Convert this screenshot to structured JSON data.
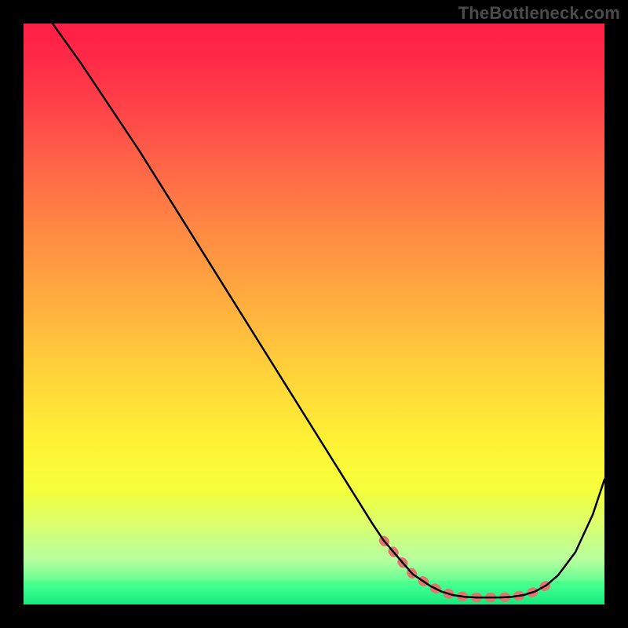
{
  "watermark": "TheBottleneck.com",
  "chart_data": {
    "type": "line",
    "title": "",
    "xlabel": "",
    "ylabel": "",
    "xlim": [
      0,
      100
    ],
    "ylim": [
      0,
      100
    ],
    "grid": false,
    "series": [
      {
        "name": "curve",
        "color": "#000000",
        "x": [
          5,
          10,
          15,
          20,
          25,
          30,
          35,
          40,
          45,
          50,
          55,
          60,
          62,
          65,
          67,
          70,
          72,
          74,
          76,
          78,
          80,
          82,
          84,
          86,
          88,
          90,
          92,
          95,
          98,
          100
        ],
        "y": [
          100,
          93,
          85.5,
          78,
          70,
          62,
          54,
          46,
          38,
          30,
          22,
          14,
          11,
          7.5,
          5.2,
          3.2,
          2.2,
          1.6,
          1.3,
          1.2,
          1.2,
          1.2,
          1.3,
          1.6,
          2.2,
          3.3,
          5.0,
          9.0,
          15.5,
          21.5
        ]
      },
      {
        "name": "highlight-band",
        "color": "#e2766f",
        "x": [
          62,
          65,
          67,
          70,
          72,
          74,
          76,
          78,
          80,
          82,
          84,
          86,
          88,
          90,
          91.5
        ],
        "y": [
          11,
          7.5,
          5.2,
          3.2,
          2.2,
          1.6,
          1.3,
          1.2,
          1.2,
          1.2,
          1.3,
          1.6,
          2.2,
          3.3,
          4.3
        ]
      }
    ]
  },
  "plot": {
    "left": 30,
    "top": 30,
    "size": 740
  }
}
